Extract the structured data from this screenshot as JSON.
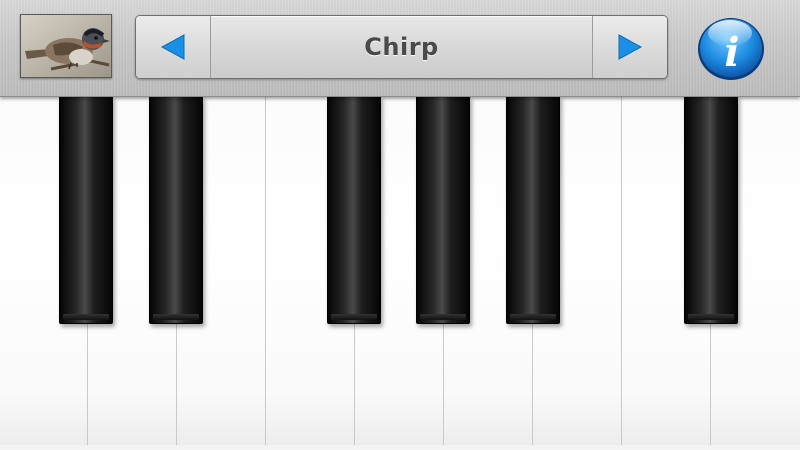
{
  "header": {
    "sound_name": "Chirp",
    "prev_icon": "left-arrow-icon",
    "next_icon": "right-arrow-icon",
    "info_icon": "info-icon",
    "info_glyph": "i",
    "thumbnail": "bird-photo",
    "accent_color": "#1a8fe6"
  },
  "keyboard": {
    "white_keys": 9,
    "black_keys": [
      "C#",
      "D#",
      "F#",
      "G#",
      "A#",
      "C#"
    ]
  }
}
